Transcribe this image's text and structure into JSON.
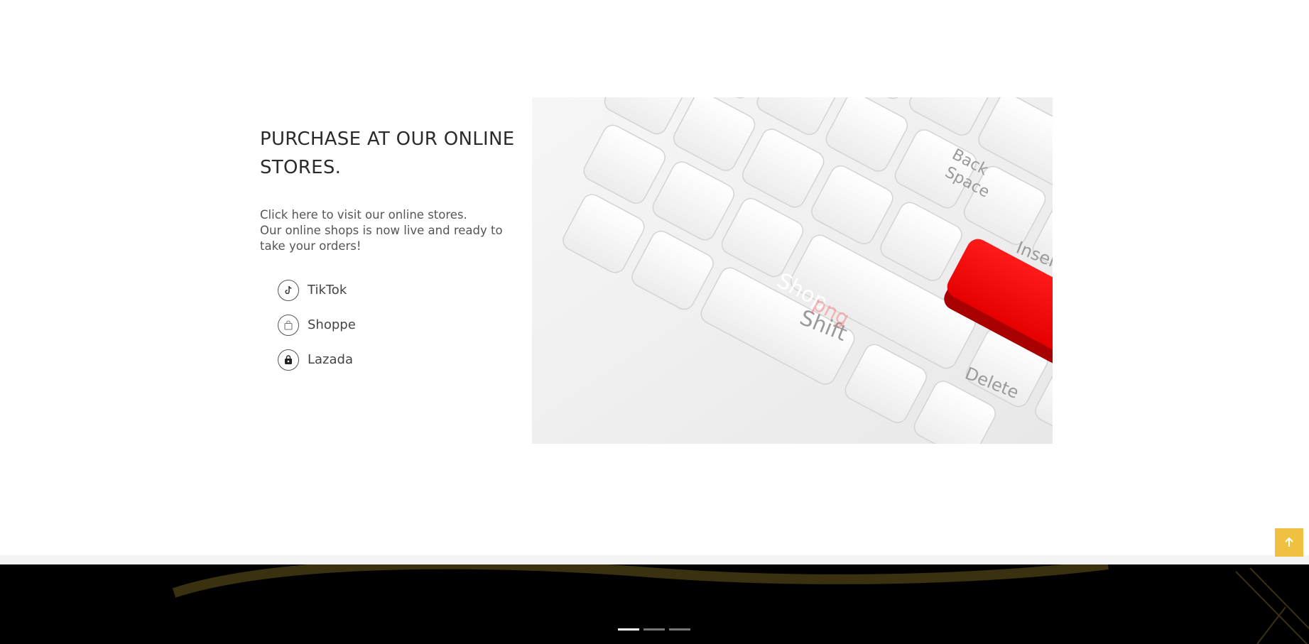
{
  "section": {
    "headline": "PURCHASE AT OUR ONLINE STORES.",
    "description_line1": "Click here to visit our online stores.",
    "description_line2": "Our online shops is now live and ready to take your orders!"
  },
  "stores": [
    {
      "label": "TikTok",
      "icon": "tiktok-icon"
    },
    {
      "label": "Shoppe",
      "icon": "shopping-bag-icon"
    },
    {
      "label": "Lazada",
      "icon": "lock-bag-icon"
    }
  ],
  "hero": {
    "keys": {
      "shop": "Shop",
      "shift": "Shift",
      "delete": "Delete",
      "insert": "Inser",
      "backspace_line1": "Back",
      "backspace_line2": "Space"
    },
    "watermark": "png"
  },
  "carousel": {
    "slide_count": 3,
    "active_index": 0
  },
  "colors": {
    "accent_yellow": "#f0c140",
    "shop_key_red": "#ff0000",
    "footer_bg": "#000000",
    "gold_swoosh": "#3a3110"
  }
}
